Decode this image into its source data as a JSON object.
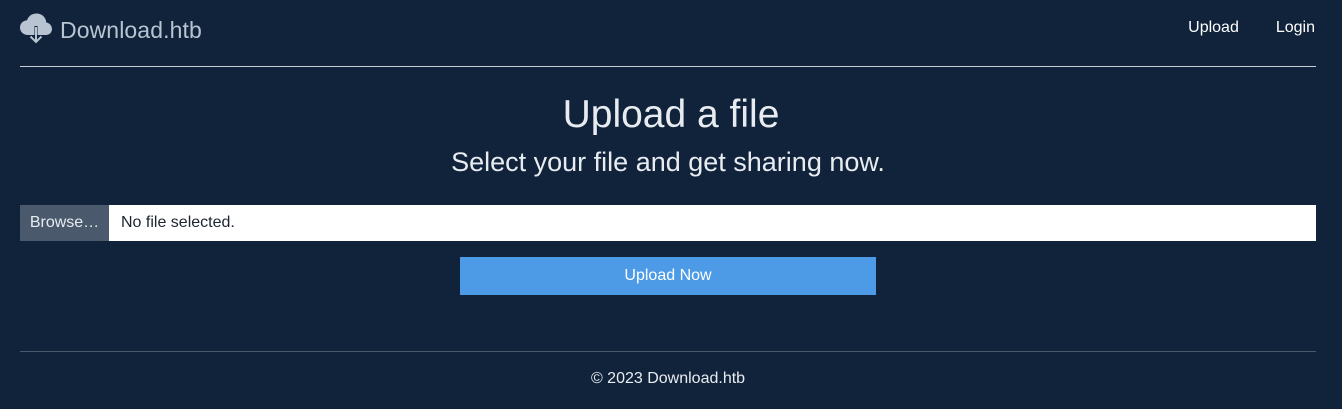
{
  "header": {
    "brand": {
      "icon": "cloud-download-icon",
      "name": "Download.htb"
    },
    "nav": {
      "upload_label": "Upload",
      "login_label": "Login"
    }
  },
  "main": {
    "title": "Upload a file",
    "subtitle": "Select your file and get sharing now.",
    "file_input": {
      "browse_label": "Browse…",
      "status_text": "No file selected."
    },
    "upload_button_label": "Upload Now"
  },
  "footer": {
    "copyright": "© 2023 Download.htb"
  },
  "colors": {
    "background": "#10233a",
    "accent_button": "#4d9be6",
    "browse_button": "#4a5a6c",
    "brand_text": "#b9c4d2"
  }
}
